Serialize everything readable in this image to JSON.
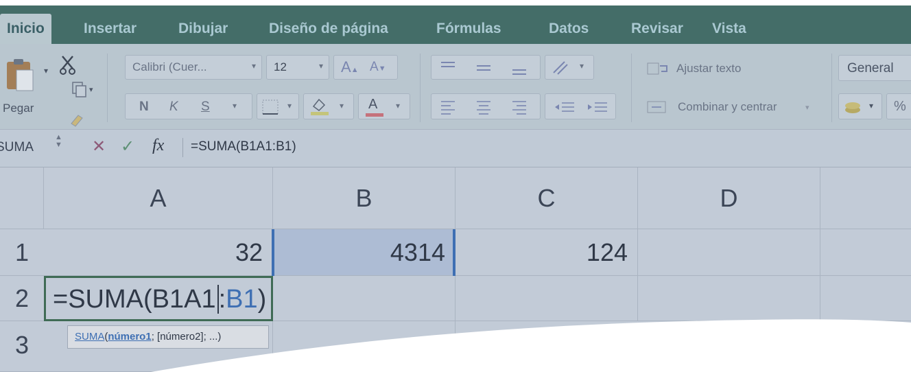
{
  "tabs": [
    {
      "label": "Inicio"
    },
    {
      "label": "Insertar"
    },
    {
      "label": "Dibujar"
    },
    {
      "label": "Diseño de página"
    },
    {
      "label": "Fórmulas"
    },
    {
      "label": "Datos"
    },
    {
      "label": "Revisar"
    },
    {
      "label": "Vista"
    }
  ],
  "ribbon": {
    "paste_label": "Pegar",
    "font_name": "Calibri (Cuer...",
    "font_size": "12",
    "increase_font": "A",
    "decrease_font": "A",
    "bold": "N",
    "italic": "K",
    "underline": "S",
    "font_color_letter": "A",
    "wrap_text": "Ajustar texto",
    "merge_center": "Combinar y centrar",
    "number_format": "General",
    "percent": "%"
  },
  "formula_bar": {
    "name_box": "SUMA",
    "fx": "fx",
    "formula": "=SUMA(B1A1:B1)"
  },
  "columns": [
    "A",
    "B",
    "C",
    "D"
  ],
  "rows": [
    "1",
    "2",
    "3"
  ],
  "cells": {
    "A1": "32",
    "B1": "4314",
    "C1": "124",
    "A2_prefix": "=SUMA(B1A1",
    "A2_colon": ":",
    "A2_ref": "B1",
    "A2_suffix": ")"
  },
  "tooltip": {
    "func": "SUMA",
    "open": "(",
    "arg1": "número1",
    "rest": "; [número2]; ...)"
  },
  "colors": {
    "tab_bar": "#446d68",
    "ribbon": "#b9c6cf",
    "grid": "#c2cbd7",
    "selected_border": "#3f6b55",
    "ref_blue": "#3e6fb3"
  }
}
